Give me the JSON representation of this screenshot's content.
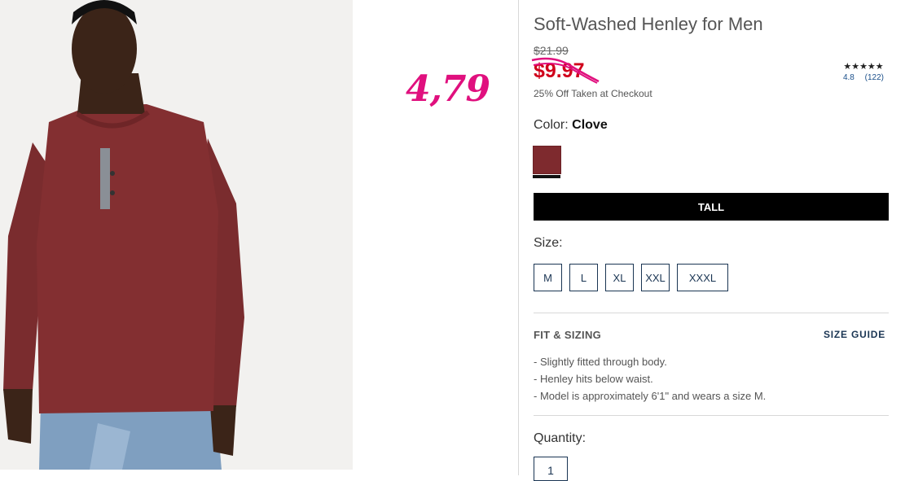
{
  "annotation": {
    "price": "4,79"
  },
  "product": {
    "title": "Soft-Washed Henley for Men",
    "original_price": "$21.99",
    "sale_price": "$9.97",
    "promo": "25% Off Taken at Checkout"
  },
  "rating": {
    "stars": "★★★★★",
    "score": "4.8",
    "count": "(122)"
  },
  "color": {
    "label": "Color:",
    "value": "Clove",
    "swatch_hex": "#7e2a2e"
  },
  "fit_type": {
    "tall_label": "TALL"
  },
  "size": {
    "label": "Size:",
    "options": [
      "M",
      "L",
      "XL",
      "XXL",
      "XXXL"
    ]
  },
  "fit_sizing": {
    "heading": "FIT & SIZING",
    "guide_link": "SIZE GUIDE",
    "bullets": [
      "Slightly fitted through body.",
      "Henley hits below waist.",
      "Model is approximately 6'1\" and wears a size M."
    ]
  },
  "quantity": {
    "label": "Quantity:",
    "value": "1"
  },
  "colors": {
    "sale_red": "#d0021b",
    "annotation_pink": "#e0107e",
    "navy": "#1a3553"
  }
}
